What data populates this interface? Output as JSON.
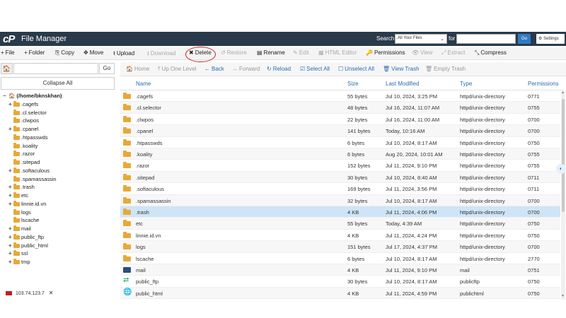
{
  "header": {
    "logo": "cP",
    "title": "File Manager",
    "search_label": "Search",
    "search_scope": "All Your Files",
    "for_label": "for",
    "go_label": "Go",
    "settings_label": "Settings"
  },
  "toolbar": [
    {
      "key": "file",
      "icon": "+",
      "label": "File",
      "disabled": false
    },
    {
      "key": "folder",
      "icon": "+",
      "label": "Folder",
      "disabled": false
    },
    {
      "key": "copy",
      "icon": "⎘",
      "label": "Copy",
      "disabled": false
    },
    {
      "key": "move",
      "icon": "✥",
      "label": "Move",
      "disabled": false
    },
    {
      "key": "upload",
      "icon": "⭱",
      "label": "Upload",
      "disabled": false
    },
    {
      "key": "download",
      "icon": "⭳",
      "label": "Download",
      "disabled": true
    },
    {
      "key": "delete",
      "icon": "✖",
      "label": "Delete",
      "disabled": false
    },
    {
      "key": "restore",
      "icon": "↺",
      "label": "Restore",
      "disabled": true
    },
    {
      "key": "rename",
      "icon": "▤",
      "label": "Rename",
      "disabled": false
    },
    {
      "key": "edit",
      "icon": "✎",
      "label": "Edit",
      "disabled": true
    },
    {
      "key": "html-editor",
      "icon": "▦",
      "label": "HTML Editor",
      "disabled": true
    },
    {
      "key": "permissions",
      "icon": "🔑",
      "label": "Permissions",
      "disabled": false
    },
    {
      "key": "view",
      "icon": "👁",
      "label": "View",
      "disabled": true
    },
    {
      "key": "extract",
      "icon": "⤢",
      "label": "Extract",
      "disabled": true
    },
    {
      "key": "compress",
      "icon": "⤡",
      "label": "Compress",
      "disabled": false
    }
  ],
  "sidebar": {
    "go_label": "Go",
    "collapse_label": "Collapse All",
    "tree": [
      {
        "label": "(/home/bknskhan)",
        "level": 0,
        "toggle": "−",
        "root": true
      },
      {
        "label": ".cagefs",
        "level": 1,
        "toggle": "+"
      },
      {
        "label": ".cl.selector",
        "level": 1,
        "toggle": ""
      },
      {
        "label": ".clwpos",
        "level": 1,
        "toggle": ""
      },
      {
        "label": ".cpanel",
        "level": 1,
        "toggle": "+"
      },
      {
        "label": ".htpasswds",
        "level": 1,
        "toggle": ""
      },
      {
        "label": ".koality",
        "level": 1,
        "toggle": ""
      },
      {
        "label": ".razor",
        "level": 1,
        "toggle": ""
      },
      {
        "label": ".sitepad",
        "level": 1,
        "toggle": ""
      },
      {
        "label": ".softaculous",
        "level": 1,
        "toggle": "+"
      },
      {
        "label": ".spamassassin",
        "level": 1,
        "toggle": ""
      },
      {
        "label": ".trash",
        "level": 1,
        "toggle": "+"
      },
      {
        "label": "etc",
        "level": 1,
        "toggle": "+"
      },
      {
        "label": "linnie.id.vn",
        "level": 1,
        "toggle": "+"
      },
      {
        "label": "logs",
        "level": 1,
        "toggle": ""
      },
      {
        "label": "lscache",
        "level": 1,
        "toggle": ""
      },
      {
        "label": "mail",
        "level": 1,
        "toggle": "+"
      },
      {
        "label": "public_ftp",
        "level": 1,
        "toggle": "+"
      },
      {
        "label": "public_html",
        "level": 1,
        "toggle": "+"
      },
      {
        "label": "ssl",
        "level": 1,
        "toggle": "+"
      },
      {
        "label": "tmp",
        "level": 1,
        "toggle": "+"
      }
    ]
  },
  "navbar": [
    {
      "key": "home",
      "icon": "🏠",
      "label": "Home",
      "active": false
    },
    {
      "key": "up-one-level",
      "icon": "⤒",
      "label": "Up One Level",
      "active": false
    },
    {
      "key": "back",
      "icon": "←",
      "label": "Back",
      "active": true
    },
    {
      "key": "forward",
      "icon": "→",
      "label": "Forward",
      "active": false
    },
    {
      "key": "reload",
      "icon": "↻",
      "label": "Reload",
      "active": true
    },
    {
      "key": "select-all",
      "icon": "☑",
      "label": "Select All",
      "active": true
    },
    {
      "key": "unselect-all",
      "icon": "☐",
      "label": "Unselect All",
      "active": true
    },
    {
      "key": "view-trash",
      "icon": "🗑",
      "label": "View Trash",
      "active": true
    },
    {
      "key": "empty-trash",
      "icon": "🗑",
      "label": "Empty Trash",
      "active": false
    }
  ],
  "table": {
    "columns": [
      "Name",
      "Size",
      "Last Modified",
      "Type",
      "Permissions"
    ],
    "rows": [
      {
        "icon": "folder",
        "name": ".cagefs",
        "size": "55 bytes",
        "modified": "Jul 10, 2024, 3:25 PM",
        "type": "httpd/unix-directory",
        "perms": "0771"
      },
      {
        "icon": "folder",
        "name": ".cl.selector",
        "size": "48 bytes",
        "modified": "Jul 16, 2024, 11:07 AM",
        "type": "httpd/unix-directory",
        "perms": "0755"
      },
      {
        "icon": "folder",
        "name": ".clwpos",
        "size": "22 bytes",
        "modified": "Jul 16, 2024, 11:00 AM",
        "type": "httpd/unix-directory",
        "perms": "0700"
      },
      {
        "icon": "folder",
        "name": ".cpanel",
        "size": "141 bytes",
        "modified": "Today, 10:16 AM",
        "type": "httpd/unix-directory",
        "perms": "0700"
      },
      {
        "icon": "folder",
        "name": ".htpasswds",
        "size": "6 bytes",
        "modified": "Jul 10, 2024, 8:17 AM",
        "type": "httpd/unix-directory",
        "perms": "0750"
      },
      {
        "icon": "folder",
        "name": ".koality",
        "size": "6 bytes",
        "modified": "Aug 20, 2024, 10:01 AM",
        "type": "httpd/unix-directory",
        "perms": "0755"
      },
      {
        "icon": "folder",
        "name": ".razor",
        "size": "152 bytes",
        "modified": "Jul 11, 2024, 9:10 PM",
        "type": "httpd/unix-directory",
        "perms": "0755"
      },
      {
        "icon": "folder",
        "name": ".sitepad",
        "size": "30 bytes",
        "modified": "Jul 10, 2024, 8:40 AM",
        "type": "httpd/unix-directory",
        "perms": "0711"
      },
      {
        "icon": "folder",
        "name": ".softaculous",
        "size": "169 bytes",
        "modified": "Jul 11, 2024, 3:56 PM",
        "type": "httpd/unix-directory",
        "perms": "0711"
      },
      {
        "icon": "folder",
        "name": ".spamassassin",
        "size": "32 bytes",
        "modified": "Jul 10, 2024, 8:17 AM",
        "type": "httpd/unix-directory",
        "perms": "0700"
      },
      {
        "icon": "folder",
        "name": ".trash",
        "size": "4 KB",
        "modified": "Jul 11, 2024, 4:06 PM",
        "type": "httpd/unix-directory",
        "perms": "0700",
        "selected": true
      },
      {
        "icon": "folder",
        "name": "etc",
        "size": "55 bytes",
        "modified": "Today, 4:39 AM",
        "type": "httpd/unix-directory",
        "perms": "0750"
      },
      {
        "icon": "folder",
        "name": "linnie.id.vn",
        "size": "4 KB",
        "modified": "Jul 11, 2024, 4:24 PM",
        "type": "httpd/unix-directory",
        "perms": "0750"
      },
      {
        "icon": "folder",
        "name": "logs",
        "size": "151 bytes",
        "modified": "Jul 17, 2024, 4:37 PM",
        "type": "httpd/unix-directory",
        "perms": "0700"
      },
      {
        "icon": "folder",
        "name": "lscache",
        "size": "6 bytes",
        "modified": "Jul 10, 2024, 8:17 AM",
        "type": "httpd/unix-directory",
        "perms": "2770"
      },
      {
        "icon": "mail",
        "name": "mail",
        "size": "4 KB",
        "modified": "Jul 11, 2024, 9:10 PM",
        "type": "mail",
        "perms": "0751"
      },
      {
        "icon": "ftp",
        "name": "public_ftp",
        "size": "30 bytes",
        "modified": "Jul 10, 2024, 8:17 AM",
        "type": "publicftp",
        "perms": "0750"
      },
      {
        "icon": "globe",
        "name": "public_html",
        "size": "4 KB",
        "modified": "Jul 11, 2024, 4:59 PM",
        "type": "publichtml",
        "perms": "0750"
      }
    ]
  },
  "status": {
    "ip": "103.74.123.7",
    "close_glyph": "✕"
  },
  "colors": {
    "topbar": "#293a4a",
    "accent": "#2a6db0",
    "folder": "#e8a838",
    "selected_row": "#cfe5f7",
    "annotation_circle": "#d21f1f"
  }
}
